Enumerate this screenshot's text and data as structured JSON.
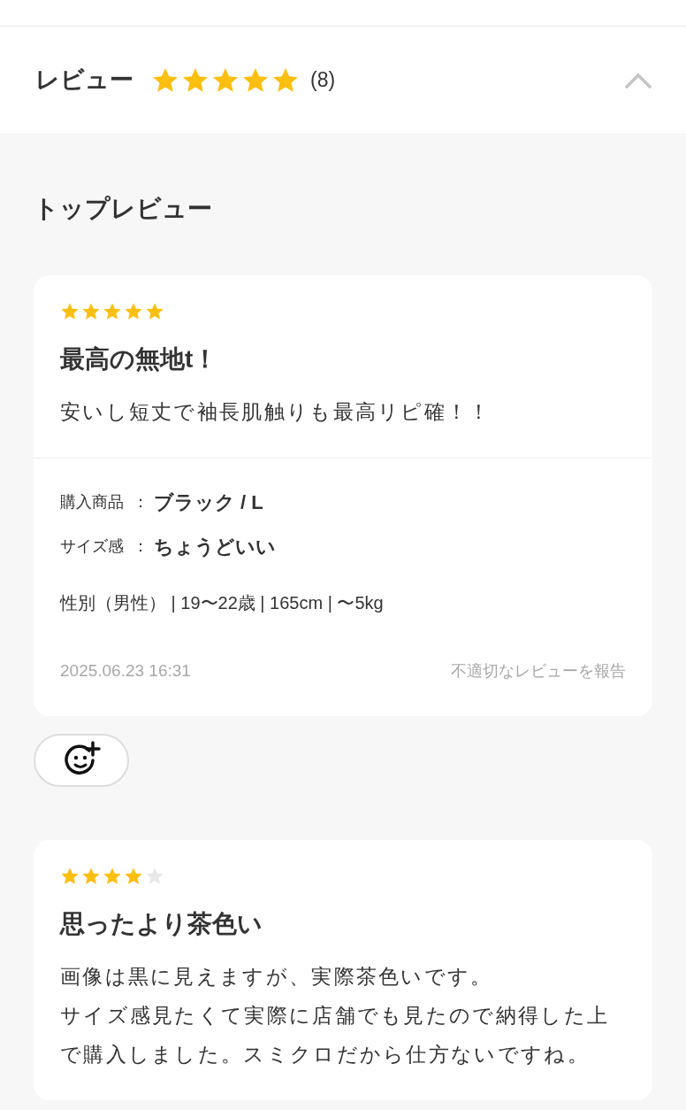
{
  "header": {
    "title": "レビュー",
    "stars": 5,
    "count": "(8)",
    "expanded": true
  },
  "section_title": "トップレビュー",
  "reviews": [
    {
      "stars": 5,
      "title": "最高の無地t！",
      "body": [
        "安いし短丈で袖長肌触りも最高リピ確！！"
      ],
      "details": [
        {
          "label": "購入商品",
          "separator": "：",
          "value": "ブラック / L"
        },
        {
          "label": "サイズ感",
          "separator": "：",
          "value": "ちょうどいい"
        }
      ],
      "profile": "性別（男性） | 19〜22歳 | 165cm | 〜5kg",
      "date": "2025.06.23 16:31",
      "report": "不適切なレビューを報告"
    },
    {
      "stars": 4,
      "title": "思ったより茶色い",
      "body": [
        "画像は黒に見えますが、実際茶色いです。",
        "サイズ感見たくて実際に店舗でも見たので納得した上で購入しました。スミクロだから仕方ないですね。"
      ]
    }
  ]
}
